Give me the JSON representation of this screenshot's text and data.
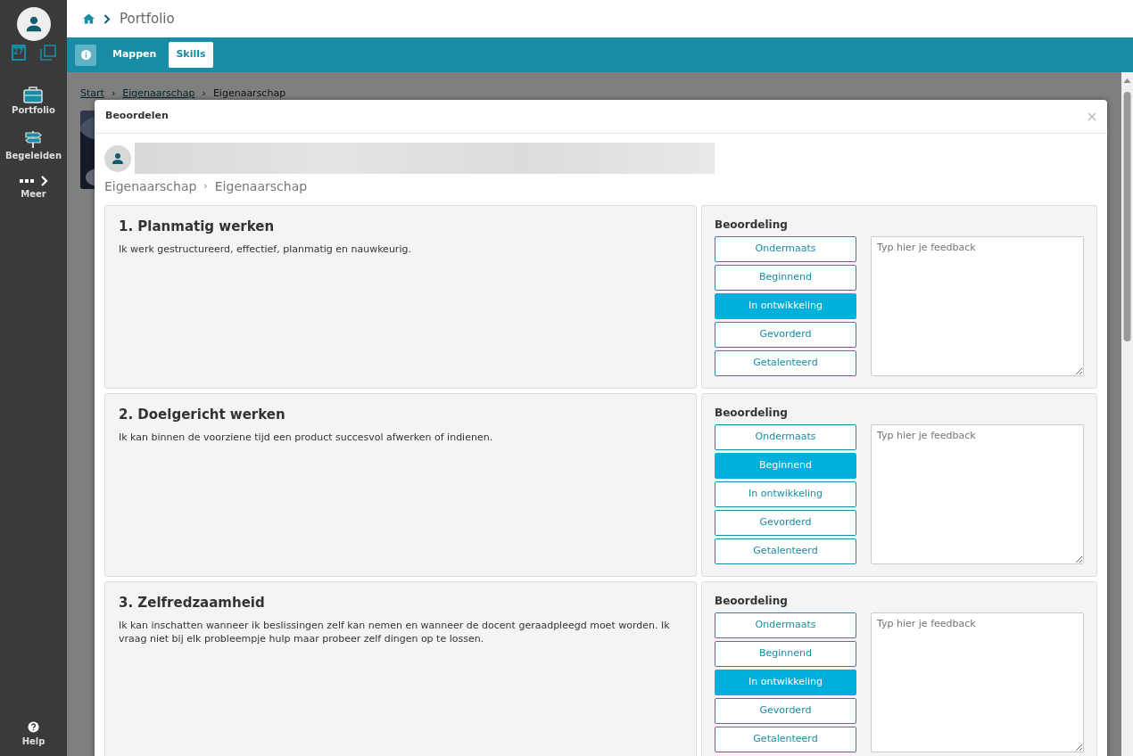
{
  "sidebar": {
    "calendar_day": "27",
    "items": [
      {
        "kind": "portfolio",
        "label": "Portfolio"
      },
      {
        "kind": "guide",
        "label": "Begeleiden"
      },
      {
        "kind": "more",
        "label": "Meer"
      }
    ],
    "help": "Help"
  },
  "header": {
    "breadcrumb": "Portfolio"
  },
  "toolbar": {
    "tabs": [
      {
        "label": "Mappen",
        "selected": false
      },
      {
        "label": "Skills",
        "selected": true
      }
    ]
  },
  "background": {
    "breadcrumb": [
      "Start",
      "Eigenaarschap",
      "Eigenaarschap"
    ],
    "separator": "›"
  },
  "modal": {
    "title": "Beoordelen",
    "breadcrumb": [
      "Eigenaarschap",
      "Eigenaarschap"
    ],
    "separator": "›",
    "skills": [
      {
        "title": "1. Planmatig werken",
        "description": "Ik werk gestructureerd, effectief, planmatig en nauwkeurig.",
        "rating_label": "Beoordeling",
        "levels": [
          {
            "label": "Ondermaats",
            "selected": false
          },
          {
            "label": "Beginnend",
            "selected": false
          },
          {
            "label": "In ontwikkeling",
            "selected": true
          },
          {
            "label": "Gevorderd",
            "selected": false
          },
          {
            "label": "Getalenteerd",
            "selected": false
          }
        ],
        "feedback": {
          "placeholder": "Typ hier je feedback"
        }
      },
      {
        "title": "2. Doelgericht werken",
        "description": "Ik kan binnen de voorziene tijd een product succesvol afwerken of indienen.",
        "rating_label": "Beoordeling",
        "levels": [
          {
            "label": "Ondermaats",
            "selected": false
          },
          {
            "label": "Beginnend",
            "selected": true
          },
          {
            "label": "In ontwikkeling",
            "selected": false
          },
          {
            "label": "Gevorderd",
            "selected": false
          },
          {
            "label": "Getalenteerd",
            "selected": false
          }
        ],
        "feedback": {
          "placeholder": "Typ hier je feedback"
        }
      },
      {
        "title": "3. Zelfredzaamheid",
        "description": "Ik kan inschatten wanneer ik beslissingen zelf kan nemen en wanneer de docent geraadpleegd moet worden. Ik vraag niet bij elk probleempje hulp maar probeer zelf dingen op te lossen.",
        "rating_label": "Beoordeling",
        "levels": [
          {
            "label": "Ondermaats",
            "selected": false
          },
          {
            "label": "Beginnend",
            "selected": false
          },
          {
            "label": "In ontwikkeling",
            "selected": true
          },
          {
            "label": "Gevorderd",
            "selected": false
          },
          {
            "label": "Getalenteerd",
            "selected": false
          }
        ],
        "feedback": {
          "placeholder": "Typ hier je feedback"
        }
      }
    ]
  }
}
